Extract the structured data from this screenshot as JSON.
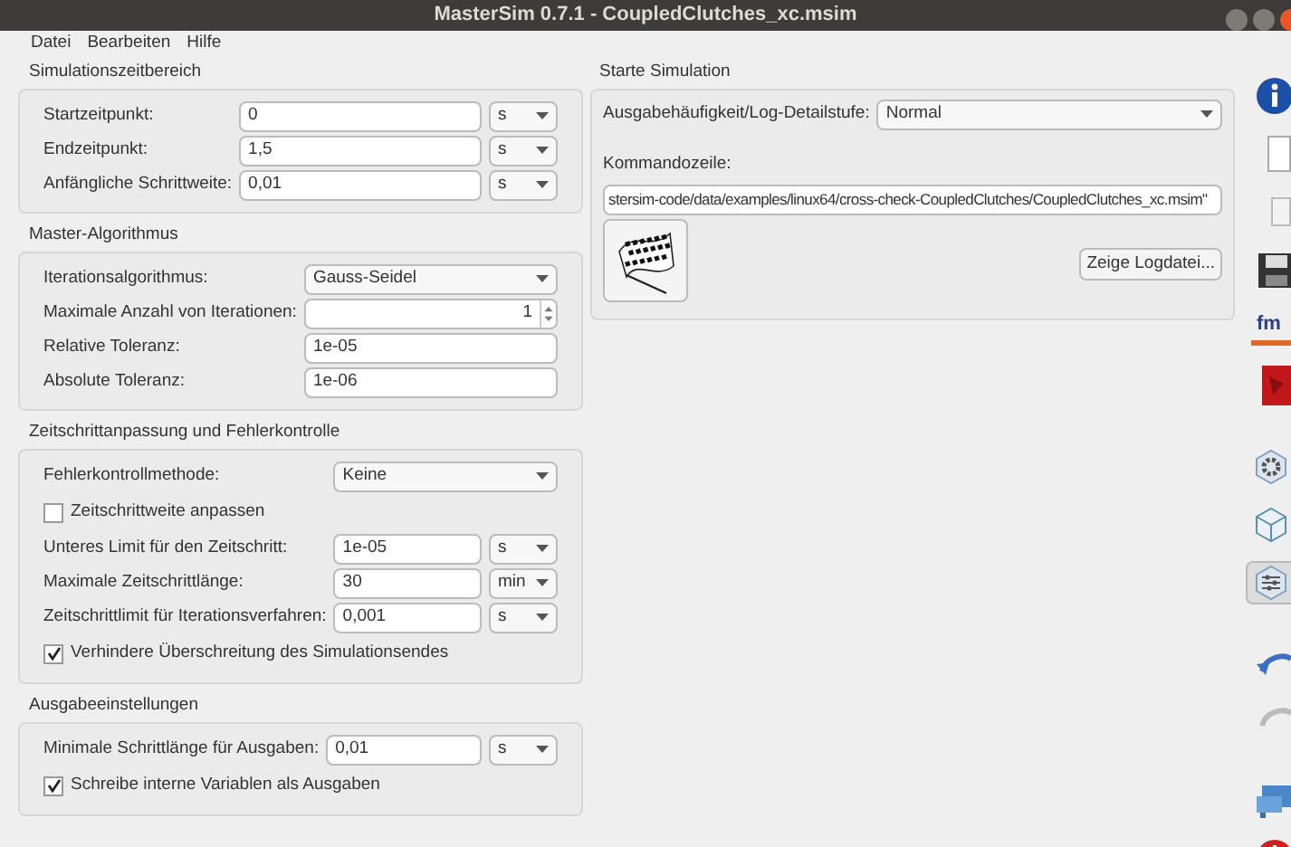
{
  "window": {
    "title": "MasterSim 0.7.1 - CoupledClutches_xc.msim"
  },
  "menu": [
    "Datei",
    "Bearbeiten",
    "Hilfe"
  ],
  "sections": [
    {
      "title": "Simulationszeitbereich",
      "rows": [
        {
          "kind": "field",
          "label": "Startzeitpunkt:",
          "value": "0",
          "unit": "s"
        },
        {
          "kind": "field",
          "label": "Endzeitpunkt:",
          "value": "1,5",
          "unit": "s"
        },
        {
          "kind": "field",
          "label": "Anfängliche Schrittweite:",
          "value": "0,01",
          "unit": "s"
        }
      ]
    },
    {
      "title": "Master-Algorithmus",
      "rows": [
        {
          "kind": "combo",
          "label": "Iterationsalgorithmus:",
          "value": "Gauss-Seidel"
        },
        {
          "kind": "spin",
          "label": "Maximale Anzahl von Iterationen:",
          "value": "1"
        },
        {
          "kind": "field",
          "label": "Relative Toleranz:",
          "value": "1e-05"
        },
        {
          "kind": "field",
          "label": "Absolute Toleranz:",
          "value": "1e-06"
        }
      ]
    },
    {
      "title": "Zeitschrittanpassung und Fehlerkontrolle",
      "rows": [
        {
          "kind": "combo",
          "label": "Fehlerkontrollmethode:",
          "value": "Keine"
        },
        {
          "kind": "check",
          "label": "Zeitschrittweite anpassen",
          "checked": false
        },
        {
          "kind": "field",
          "label": "Unteres Limit für den Zeitschritt:",
          "value": "1e-05",
          "unit": "s"
        },
        {
          "kind": "field",
          "label": "Maximale Zeitschrittlänge:",
          "value": "30",
          "unit": "min"
        },
        {
          "kind": "field",
          "label": "Zeitschrittlimit für Iterationsverfahren:",
          "value": "0,001",
          "unit": "s"
        },
        {
          "kind": "check",
          "label": "Verhindere Überschreitung des Simulationsendes",
          "checked": true
        }
      ]
    },
    {
      "title": "Ausgabeeinstellungen",
      "rows": [
        {
          "kind": "field",
          "label": "Minimale Schrittlänge für Ausgaben:",
          "value": "0,01",
          "unit": "s"
        },
        {
          "kind": "check",
          "label": "Schreibe interne Variablen als Ausgaben",
          "checked": true
        }
      ]
    }
  ],
  "simulation": {
    "title": "Starte Simulation",
    "log_label": "Ausgabehäufigkeit/Log-Detailstufe:",
    "log_value": "Normal",
    "command_label": "Kommandozeile:",
    "command": "stersim-code/data/examples/linux64/cross-check-CoupledClutches/CoupledClutches_xc.msim\"",
    "logfile_button": "Zeige Logdatei..."
  },
  "toolbar": [
    {
      "kind": "info",
      "selected": false
    },
    {
      "kind": "new",
      "selected": false
    },
    {
      "kind": "open",
      "selected": false
    },
    {
      "kind": "save",
      "selected": false
    },
    {
      "kind": "fmu",
      "label": "fm",
      "selected": false
    },
    {
      "kind": "red",
      "selected": false
    },
    {
      "kind": "gear",
      "selected": false
    },
    {
      "kind": "cube",
      "selected": false
    },
    {
      "kind": "sliders",
      "selected": true
    },
    {
      "kind": "undo",
      "selected": false
    },
    {
      "kind": "redo",
      "selected": false
    },
    {
      "kind": "monitor",
      "selected": false
    },
    {
      "kind": "power",
      "selected": false
    }
  ]
}
